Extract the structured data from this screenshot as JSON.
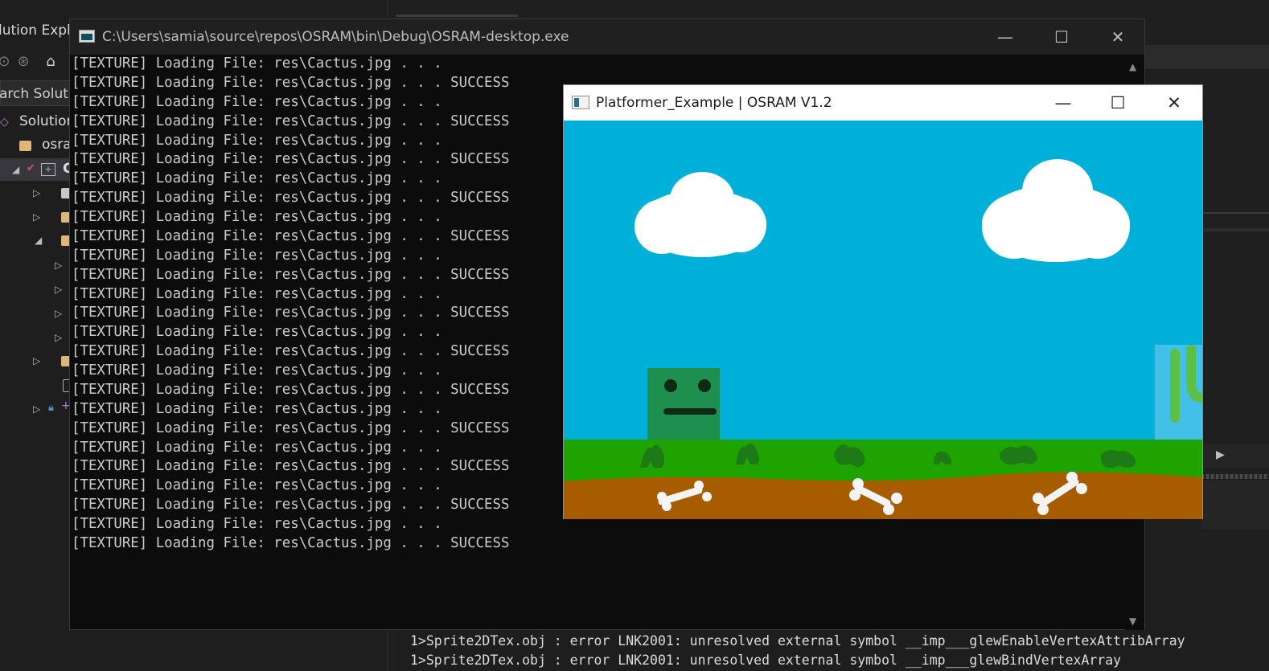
{
  "solution_explorer": {
    "title": "lution Explo",
    "search_placeholder": "arch Solutio",
    "tree": [
      {
        "label": "Solution",
        "icon": "solution-icon"
      },
      {
        "label": "osra",
        "icon": "folder-icon"
      },
      {
        "label": "C",
        "icon": "project-icon"
      }
    ]
  },
  "console": {
    "title": "C:\\Users\\samia\\source\\repos\\OSRAM\\bin\\Debug\\OSRAM-desktop.exe",
    "lines": [
      "[TEXTURE] Loading File: res\\Cactus.jpg . . .",
      "[TEXTURE] Loading File: res\\Cactus.jpg . . . SUCCESS",
      "[TEXTURE] Loading File: res\\Cactus.jpg . . .",
      "[TEXTURE] Loading File: res\\Cactus.jpg . . . SUCCESS",
      "[TEXTURE] Loading File: res\\Cactus.jpg . . .",
      "[TEXTURE] Loading File: res\\Cactus.jpg . . . SUCCESS",
      "[TEXTURE] Loading File: res\\Cactus.jpg . . .",
      "[TEXTURE] Loading File: res\\Cactus.jpg . . . SUCCESS",
      "[TEXTURE] Loading File: res\\Cactus.jpg . . .",
      "[TEXTURE] Loading File: res\\Cactus.jpg . . . SUCCESS",
      "[TEXTURE] Loading File: res\\Cactus.jpg . . .",
      "[TEXTURE] Loading File: res\\Cactus.jpg . . . SUCCESS",
      "[TEXTURE] Loading File: res\\Cactus.jpg . . .",
      "[TEXTURE] Loading File: res\\Cactus.jpg . . . SUCCESS",
      "[TEXTURE] Loading File: res\\Cactus.jpg . . .",
      "[TEXTURE] Loading File: res\\Cactus.jpg . . . SUCCESS",
      "[TEXTURE] Loading File: res\\Cactus.jpg . . .",
      "[TEXTURE] Loading File: res\\Cactus.jpg . . . SUCCESS",
      "[TEXTURE] Loading File: res\\Cactus.jpg . . .",
      "[TEXTURE] Loading File: res\\Cactus.jpg . . . SUCCESS",
      "[TEXTURE] Loading File: res\\Cactus.jpg . . .",
      "[TEXTURE] Loading File: res\\Cactus.jpg . . . SUCCESS",
      "[TEXTURE] Loading File: res\\Cactus.jpg . . .",
      "[TEXTURE] Loading File: res\\Cactus.jpg . . . SUCCESS",
      "[TEXTURE] Loading File: res\\Cactus.jpg . . .",
      "[TEXTURE] Loading File: res\\Cactus.jpg . . . SUCCESS"
    ]
  },
  "game": {
    "title": "Platformer_Example | OSRAM V1.2",
    "colors": {
      "sky": "#00b0d8",
      "grass": "#1fa300",
      "dirt": "#a75c00",
      "player": "#1f8f4f",
      "bone": "#f4f4f4"
    }
  },
  "output": {
    "lines": [
      "1>Sprite2DTex.obj : error LNK2001: unresolved external symbol __imp___glewEnableVertexAttribArray",
      "1>Sprite2DTex.obj : error LNK2001: unresolved external symbol __imp___glewBindVertexArray"
    ]
  }
}
